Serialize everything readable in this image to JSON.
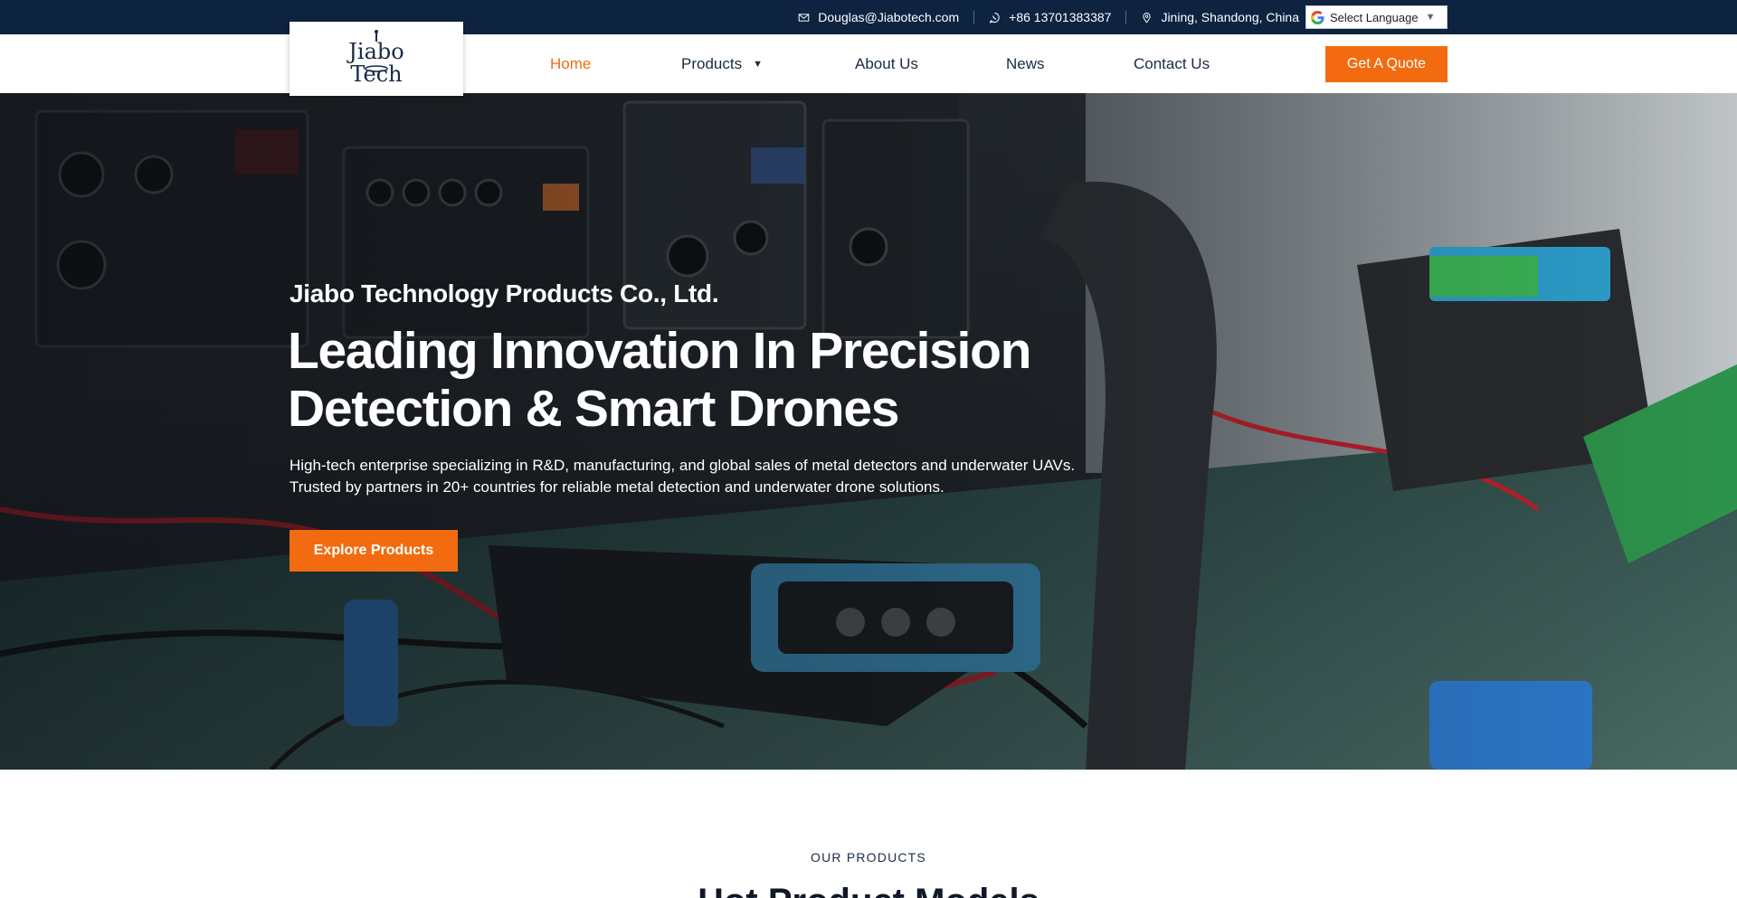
{
  "topbar": {
    "email": "Douglas@Jiabotech.com",
    "phone": "+86 13701383387",
    "location": "Jining, Shandong, China",
    "language_label": "Select Language",
    "language_arrow": "▼"
  },
  "header": {
    "logo_text_line1": "Jiabo",
    "logo_text_line2": "Tech",
    "nav": [
      {
        "label": "Home",
        "active": true
      },
      {
        "label": "Products",
        "has_dropdown": true
      },
      {
        "label": "About Us"
      },
      {
        "label": "News"
      },
      {
        "label": "Contact Us"
      }
    ],
    "quote_button": "Get A Quote"
  },
  "hero": {
    "company": "Jiabo Technology Products Co., Ltd.",
    "title": "Leading Innovation In Precision Detection & Smart Drones",
    "description": "High-tech enterprise specializing in R&D, manufacturing, and global sales of metal detectors and underwater UAVs. Trusted by partners in 20+ countries for reliable metal detection and underwater drone solutions.",
    "button": "Explore Products"
  },
  "products": {
    "label": "OUR PRODUCTS",
    "heading": "Hot Product Models"
  },
  "colors": {
    "topbar_bg": "#0d2340",
    "accent": "#f36b10",
    "nav_text": "#1a2b46"
  },
  "icons": [
    "mail-icon",
    "whatsapp-icon",
    "location-pin-icon",
    "google-icon",
    "caret-down-icon"
  ]
}
